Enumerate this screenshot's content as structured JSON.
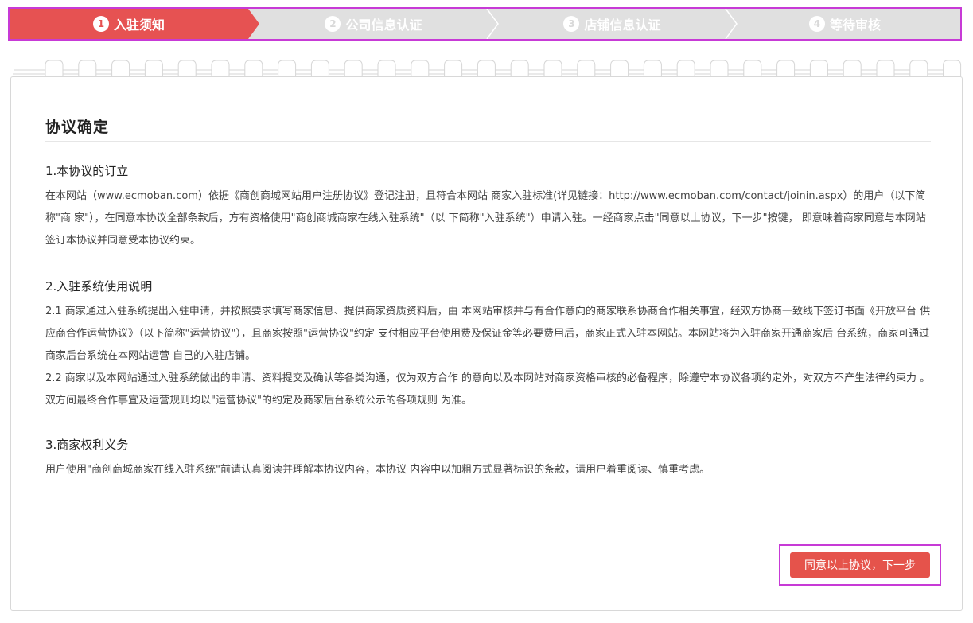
{
  "steps": [
    {
      "num": "1",
      "label": "入驻须知",
      "active": true
    },
    {
      "num": "2",
      "label": "公司信息认证",
      "active": false
    },
    {
      "num": "3",
      "label": "店铺信息认证",
      "active": false
    },
    {
      "num": "4",
      "label": "等待审核",
      "active": false
    }
  ],
  "colors": {
    "active_step": "#e65252",
    "inactive_step": "#d9d9d9",
    "button": "#e5534b",
    "highlight_border": "#c73ad6"
  },
  "agreement": {
    "title": "协议确定",
    "sections": [
      {
        "heading": "1.本协议的订立",
        "paragraphs": [
          "在本网站（www.ecmoban.com）依据《商创商城网站用户注册协议》登记注册，且符合本网站 商家入驻标准(详见链接：http://www.ecmoban.com/contact/joinin.aspx）的用户（以下简称\"商 家\"），在同意本协议全部条款后，方有资格使用\"商创商城商家在线入驻系统\"（以 下简称\"入驻系统\"）申请入驻。一经商家点击\"同意以上协议，下一步\"按键， 即意味着商家同意与本网站签订本协议并同意受本协议约束。"
        ]
      },
      {
        "heading": "2.入驻系统使用说明",
        "paragraphs": [
          "2.1 商家通过入驻系统提出入驻申请，并按照要求填写商家信息、提供商家资质资料后，由 本网站审核并与有合作意向的商家联系协商合作相关事宜，经双方协商一致线下签订书面《开放平台 供应商合作运营协议》（以下简称\"运营协议\"），且商家按照\"运营协议\"约定 支付相应平台使用费及保证金等必要费用后，商家正式入驻本网站。本网站将为入驻商家开通商家后 台系统，商家可通过商家后台系统在本网站运营 自己的入驻店铺。",
          "2.2 商家以及本网站通过入驻系统做出的申请、资料提交及确认等各类沟通，仅为双方合作 的意向以及本网站对商家资格审核的必备程序，除遵守本协议各项约定外，对双方不产生法律约束力 。双方间最终合作事宜及运营规则均以\"运营协议\"的约定及商家后台系统公示的各项规则 为准。"
        ]
      },
      {
        "heading": "3.商家权利义务",
        "paragraphs": [
          "用户使用\"商创商城商家在线入驻系统\"前请认真阅读并理解本协议内容，本协议 内容中以加粗方式显著标识的条款，请用户着重阅读、慎重考虑。"
        ]
      }
    ]
  },
  "button": {
    "agree_label": "同意以上协议，下一步"
  }
}
